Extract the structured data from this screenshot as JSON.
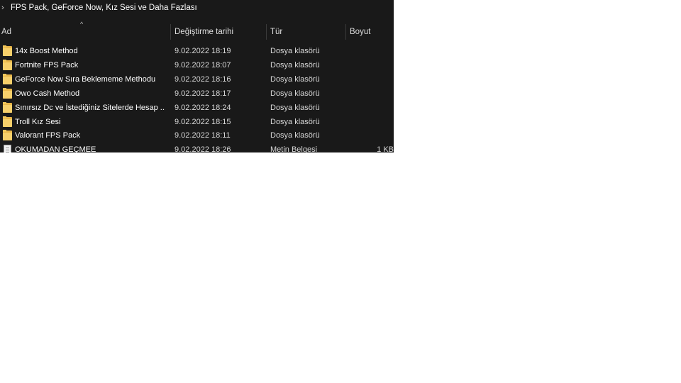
{
  "address": {
    "path": "FPS Pack, GeForce Now, Kız Sesi  ve Daha Fazlası"
  },
  "columns": [
    {
      "label": "Ad"
    },
    {
      "label": "Değiştirme tarihi"
    },
    {
      "label": "Tür"
    },
    {
      "label": "Boyut"
    }
  ],
  "rows": [
    {
      "name": "14x Boost Method",
      "date": "9.02.2022 18:19",
      "type": "Dosya klasörü",
      "size": "",
      "icon": "folder-icon"
    },
    {
      "name": "Fortnite FPS Pack",
      "date": "9.02.2022 18:07",
      "type": "Dosya klasörü",
      "size": "",
      "icon": "folder-icon"
    },
    {
      "name": "GeForce Now Sıra Beklememe Methodu",
      "date": "9.02.2022 18:16",
      "type": "Dosya klasörü",
      "size": "",
      "icon": "folder-icon"
    },
    {
      "name": "Owo Cash Method",
      "date": "9.02.2022 18:17",
      "type": "Dosya klasörü",
      "size": "",
      "icon": "folder-icon"
    },
    {
      "name": "Sınırsız Dc ve İstediğiniz Sitelerde Hesap ...",
      "date": "9.02.2022 18:24",
      "type": "Dosya klasörü",
      "size": "",
      "icon": "folder-icon"
    },
    {
      "name": "Troll Kız Sesi",
      "date": "9.02.2022 18:15",
      "type": "Dosya klasörü",
      "size": "",
      "icon": "folder-icon"
    },
    {
      "name": "Valorant FPS Pack",
      "date": "9.02.2022 18:11",
      "type": "Dosya klasörü",
      "size": "",
      "icon": "folder-icon"
    },
    {
      "name": "OKUMADAN GEÇMEE",
      "date": "9.02.2022 18:26",
      "type": "Metin Belgesi",
      "size": "1 KB",
      "icon": "text-document-icon"
    }
  ],
  "theme": {
    "background": "#191919",
    "folder": "#f7d06b",
    "text": "#ffffff"
  }
}
